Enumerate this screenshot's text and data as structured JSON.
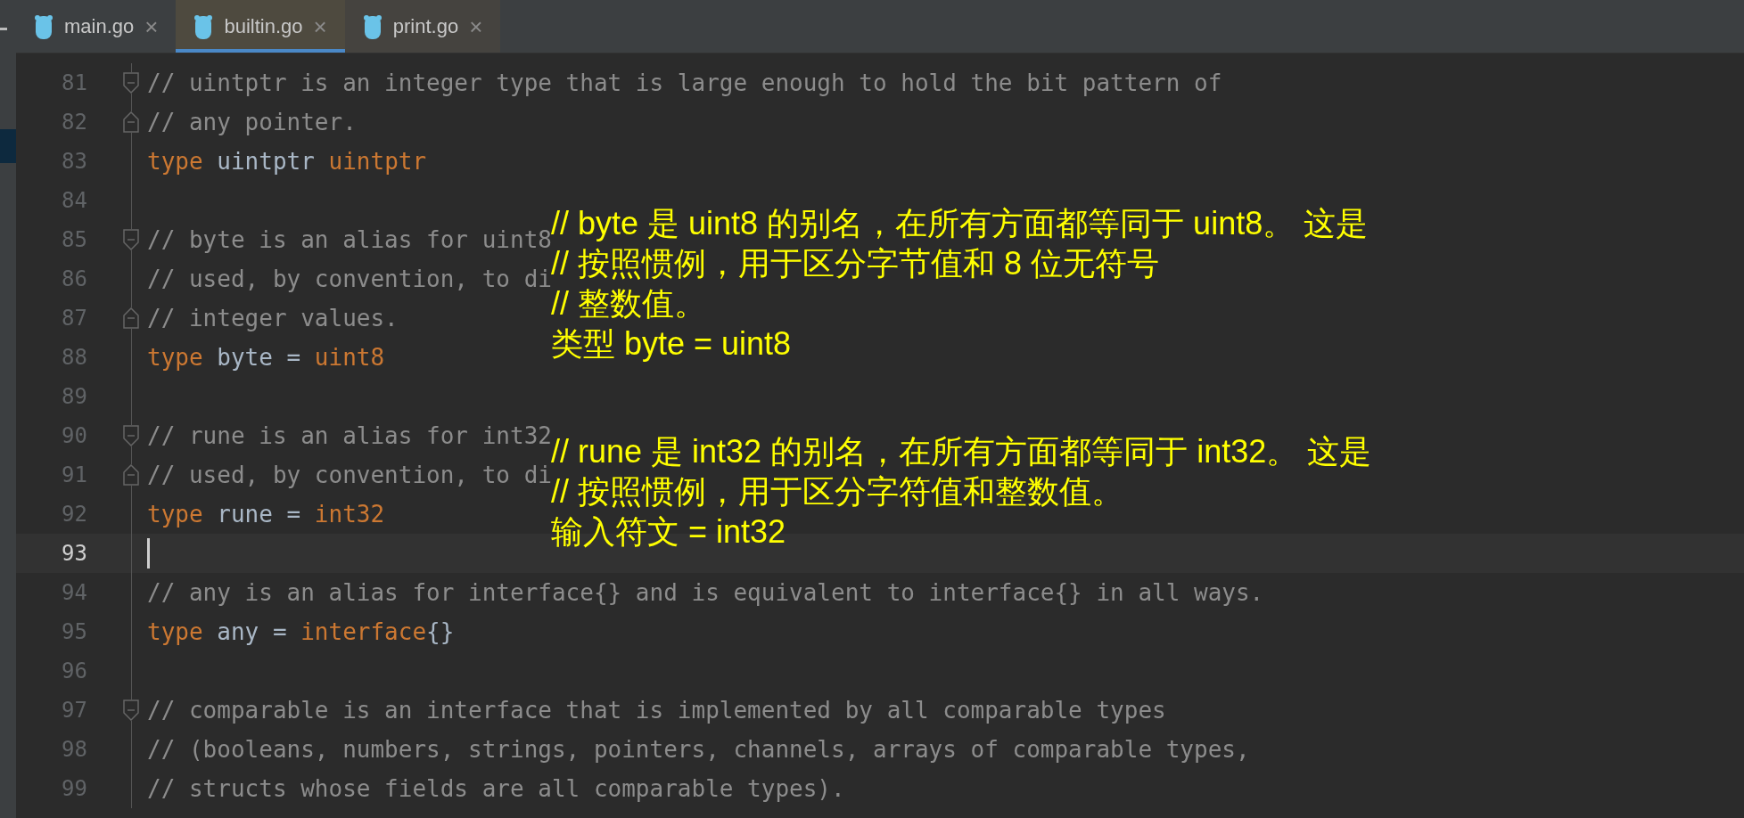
{
  "tabs": [
    {
      "label": "main.go",
      "close": "×",
      "selected": false
    },
    {
      "label": "builtin.go",
      "close": "×",
      "selected": true
    },
    {
      "label": "print.go",
      "close": "×",
      "selected": false
    }
  ],
  "editor": {
    "lines": [
      {
        "number": "81",
        "fold_start": true,
        "fold_end": false,
        "current": false,
        "tokens": [
          {
            "kind": "comment",
            "text": "// uintptr is an integer type that is large enough to hold the bit pattern of"
          }
        ]
      },
      {
        "number": "82",
        "fold_start": false,
        "fold_end": true,
        "current": false,
        "tokens": [
          {
            "kind": "comment",
            "text": "// any pointer."
          }
        ]
      },
      {
        "number": "83",
        "fold_start": false,
        "fold_end": false,
        "current": false,
        "tokens": [
          {
            "kind": "keyword",
            "text": "type"
          },
          {
            "kind": "plain",
            "text": " uintptr "
          },
          {
            "kind": "keyword",
            "text": "uintptr"
          }
        ]
      },
      {
        "number": "84",
        "fold_start": false,
        "fold_end": false,
        "current": false
      },
      {
        "number": "85",
        "fold_start": true,
        "fold_end": false,
        "current": false,
        "tokens": [
          {
            "kind": "comment",
            "text": "// byte is an alias for uint8"
          }
        ]
      },
      {
        "number": "86",
        "fold_start": false,
        "fold_end": false,
        "current": false,
        "tokens": [
          {
            "kind": "comment",
            "text": "// used, by convention, to di"
          }
        ]
      },
      {
        "number": "87",
        "fold_start": false,
        "fold_end": true,
        "current": false,
        "tokens": [
          {
            "kind": "comment",
            "text": "// integer values."
          }
        ]
      },
      {
        "number": "88",
        "fold_start": false,
        "fold_end": false,
        "current": false,
        "tokens": [
          {
            "kind": "keyword",
            "text": "type"
          },
          {
            "kind": "plain",
            "text": " byte = "
          },
          {
            "kind": "keyword",
            "text": "uint8"
          }
        ]
      },
      {
        "number": "89",
        "fold_start": false,
        "fold_end": false,
        "current": false
      },
      {
        "number": "90",
        "fold_start": true,
        "fold_end": false,
        "current": false,
        "tokens": [
          {
            "kind": "comment",
            "text": "// rune is an alias for int32"
          }
        ]
      },
      {
        "number": "91",
        "fold_start": false,
        "fold_end": true,
        "current": false,
        "tokens": [
          {
            "kind": "comment",
            "text": "// used, by convention, to di"
          }
        ]
      },
      {
        "number": "92",
        "fold_start": false,
        "fold_end": false,
        "current": false,
        "tokens": [
          {
            "kind": "keyword",
            "text": "type"
          },
          {
            "kind": "plain",
            "text": " rune = "
          },
          {
            "kind": "keyword",
            "text": "int32"
          }
        ]
      },
      {
        "number": "93",
        "fold_start": false,
        "fold_end": false,
        "current": true
      },
      {
        "number": "94",
        "fold_start": false,
        "fold_end": false,
        "current": false,
        "tokens": [
          {
            "kind": "comment",
            "text": "// any is an alias for interface{} and is equivalent to interface{} in all ways."
          }
        ]
      },
      {
        "number": "95",
        "fold_start": false,
        "fold_end": false,
        "current": false,
        "tokens": [
          {
            "kind": "keyword",
            "text": "type"
          },
          {
            "kind": "plain",
            "text": " any = "
          },
          {
            "kind": "keyword",
            "text": "interface"
          },
          {
            "kind": "plain",
            "text": "{}"
          }
        ]
      },
      {
        "number": "96",
        "fold_start": false,
        "fold_end": false,
        "current": false
      },
      {
        "number": "97",
        "fold_start": true,
        "fold_end": false,
        "current": false,
        "tokens": [
          {
            "kind": "comment",
            "text": "// comparable is an interface that is implemented by all comparable types"
          }
        ]
      },
      {
        "number": "98",
        "fold_start": false,
        "fold_end": false,
        "current": false,
        "tokens": [
          {
            "kind": "comment",
            "text": "// (booleans, numbers, strings, pointers, channels, arrays of comparable types,"
          }
        ]
      },
      {
        "number": "99",
        "fold_start": false,
        "fold_end": false,
        "current": false,
        "tokens": [
          {
            "kind": "comment",
            "text": "// structs whose fields are all comparable types)."
          }
        ]
      }
    ]
  },
  "annotations": [
    {
      "lines": [
        "// byte 是 uint8 的别名，在所有方面都等同于 uint8。 这是",
        "// 按照惯例，用于区分字节值和 8 位无符号",
        "// 整数值。",
        "类型 byte = uint8"
      ]
    },
    {
      "lines": [
        "// rune 是 int32 的别名，在所有方面都等同于 int32。 这是",
        "// 按照惯例，用于区分字符值和整数值。",
        "输入符文 = int32"
      ]
    }
  ]
}
